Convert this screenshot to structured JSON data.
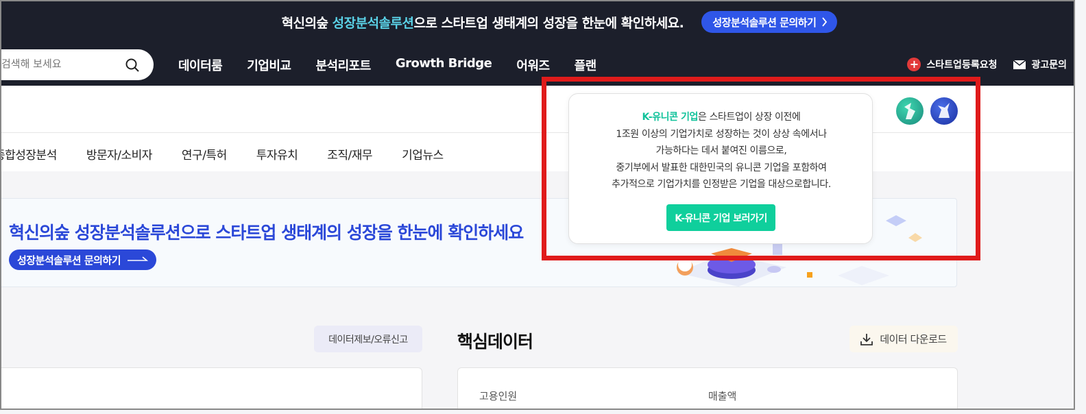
{
  "promo": {
    "text_before": "혁신의숲 ",
    "text_highlight": "성장분석솔루션",
    "text_after": "으로 스타트업 생태계의 성장을 한눈에 확인하세요.",
    "button_label": "성장분석솔루션 문의하기"
  },
  "nav": {
    "search_placeholder": "검색해 보세요",
    "items": [
      "데이터룸",
      "기업비교",
      "분석리포트",
      "Growth Bridge",
      "어워즈",
      "플랜"
    ],
    "register_label": "스타트업등록요청",
    "ad_label": "광고문의"
  },
  "sub_tabs": [
    "종합성장분석",
    "방문자/소비자",
    "연구/특허",
    "투자유치",
    "조직/재무",
    "기업뉴스"
  ],
  "banner": {
    "title": "혁신의숲 성장분석솔루션으로 스타트업 생태계의 성장을 한눈에 확인하세요",
    "button_label": "성장분석솔루션 문의하기"
  },
  "popover": {
    "highlight": "K-유니콘 기업",
    "line1_rest": "은 스타트업이 상장 이전에",
    "line2": "1조원 이상의 기업가치로 성장하는 것이 상상 속에서나",
    "line3": "가능하다는 데서 붙여진 이름으로,",
    "line4": "중기부에서 발표한 대한민국의 유니콘 기업을 포함하여",
    "line5": "추가적으로 기업가치를 인정받은 기업을 대상으로합니다.",
    "button_label": "K-유니콘 기업 보러가기"
  },
  "report_button": "데이터제보/오류신고",
  "core_title": "핵심데이터",
  "download_button": "데이터 다운로드",
  "metrics": {
    "employees_label": "고용인원",
    "revenue_label": "매출액"
  },
  "colors": {
    "dark_bg": "#1c1f2b",
    "accent_blue": "#2b48d8",
    "accent_green": "#0fcf9c",
    "highlight_red": "#e01b1b"
  }
}
